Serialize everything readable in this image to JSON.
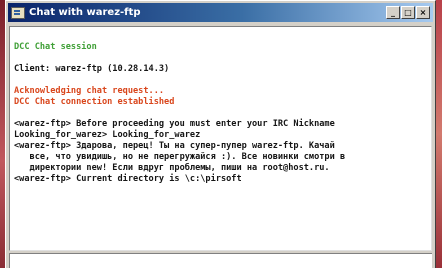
{
  "window": {
    "title": "Chat with warez-ftp"
  },
  "title_buttons": {
    "minimize": "_",
    "maximize": "□",
    "close": "×"
  },
  "chat": {
    "session_label": "DCC Chat session",
    "client_line": "Client: warez-ftp (10.28.14.3)",
    "ack_line": "Acknowledging chat request...",
    "established_line": "DCC Chat connection established",
    "messages": [
      "<warez-ftp> Before proceeding you must enter your IRC Nickname",
      "Looking_for_warez> Looking_for_warez",
      "<warez-ftp> Здарова, перец! Ты на супер-пупер warez-ftp. Качай",
      "   все, что увидишь, но не перегружайся :). Все новинки смотри в",
      "   директории new! Если вдруг проблемы, пиши на root@host.ru.",
      "<warez-ftp> Current directory is \\c:\\pirsoft"
    ]
  },
  "colors": {
    "title_bar_start": "#0a246a",
    "title_bar_end": "#a6caf0",
    "status_green": "#3f9f36",
    "status_red": "#d9461c",
    "text": "#151515"
  }
}
